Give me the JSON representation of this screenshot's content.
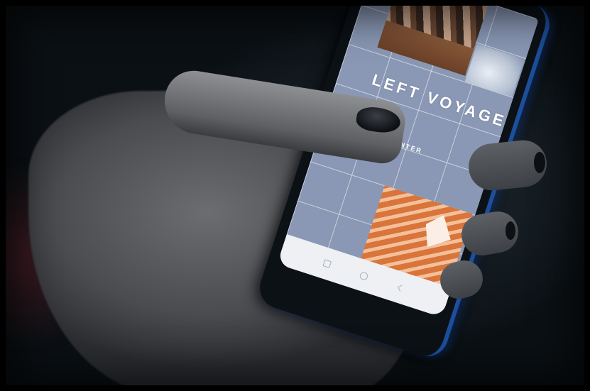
{
  "screen": {
    "title_text": "LEFT VOYAGE",
    "enter_label": "ENTER"
  },
  "navbar": {
    "icons": [
      "recents-icon",
      "home-icon",
      "back-icon"
    ]
  },
  "colors": {
    "screen_grid": "#8a98b5",
    "phone_frame_accent": "#1c4f9c",
    "nail_polish": "#0e1014",
    "photo_orange": "#d9743a"
  }
}
